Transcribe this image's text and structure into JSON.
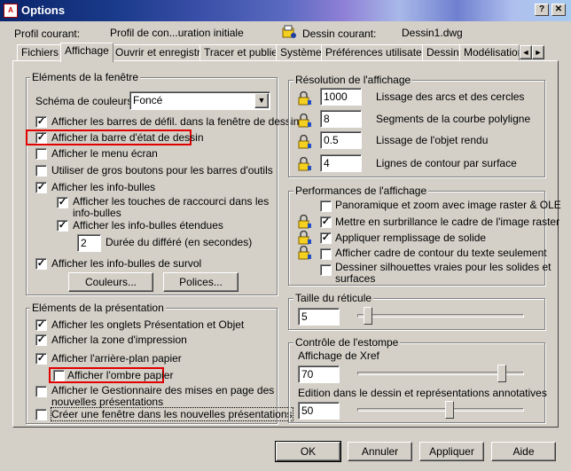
{
  "window": {
    "app_icon_text": "A",
    "title": "Options",
    "help_glyph": "?",
    "close_glyph": "✕"
  },
  "header": {
    "profile_label": "Profil courant:",
    "profile_value": "Profil de con...uration initiale",
    "drawing_label": "Dessin courant:",
    "drawing_value": "Dessin1.dwg"
  },
  "tabs": [
    {
      "label": "Fichiers"
    },
    {
      "label": "Affichage"
    },
    {
      "label": "Ouvrir et enregistrer"
    },
    {
      "label": "Tracer et publier"
    },
    {
      "label": "Système"
    },
    {
      "label": "Préférences utilisateur"
    },
    {
      "label": "Dessin"
    },
    {
      "label": "Modélisation 3D"
    }
  ],
  "tab_scroll": {
    "left": "◄",
    "right": "►"
  },
  "window_elements": {
    "title": "Eléments de la fenêtre",
    "scheme_label": "Schéma de couleurs:",
    "scheme_value": "Foncé",
    "checkboxes": [
      {
        "label": "Afficher les barres de défil. dans la fenêtre de dessin",
        "checked": true
      },
      {
        "label": "Afficher la barre d'état de dessin",
        "checked": true
      },
      {
        "label": "Afficher le menu écran",
        "checked": false
      },
      {
        "label": "Utiliser de gros boutons pour les barres d'outils",
        "checked": false
      },
      {
        "label": "Afficher les info-bulles",
        "checked": true
      }
    ],
    "sub_shortcut_line1": "Afficher les touches de raccourci dans les",
    "sub_shortcut_line2": "info-bulles",
    "sub_extended": "Afficher les info-bulles étendues",
    "delay_value": "2",
    "delay_label": "Durée du différé (en secondes)",
    "rollover": "Afficher les info-bulles de survol",
    "colors_button": "Couleurs...",
    "fonts_button": "Polices..."
  },
  "layout_elements": {
    "title": "Eléments de la présentation",
    "checkboxes": [
      {
        "label": "Afficher les onglets Présentation et Objet",
        "checked": true
      },
      {
        "label": "Afficher la zone d'impression",
        "checked": true
      },
      {
        "label": "Afficher l'arrière-plan papier",
        "checked": true
      }
    ],
    "shadow": "Afficher l'ombre papier",
    "page_setup_line1": "Afficher le Gestionnaire des mises en page des",
    "page_setup_line2": "nouvelles présentations",
    "create_viewport": "Créer une fenêtre dans les nouvelles présentations"
  },
  "resolution": {
    "title": "Résolution de l'affichage",
    "rows": [
      {
        "value": "1000",
        "label": "Lissage des arcs et des cercles"
      },
      {
        "value": "8",
        "label": "Segments de la courbe polyligne"
      },
      {
        "value": "0.5",
        "label": "Lissage de l'objet rendu"
      },
      {
        "value": "4",
        "label": "Lignes de contour par surface"
      }
    ]
  },
  "performance": {
    "title": "Performances de l'affichage",
    "items": [
      {
        "label": "Panoramique et zoom avec image raster & OLE",
        "checked": false
      },
      {
        "label": "Mettre en surbrillance le cadre de l'image raster",
        "checked": true
      },
      {
        "label": "Appliquer remplissage de solide",
        "checked": true
      },
      {
        "label": "Afficher cadre de contour du texte seulement",
        "checked": false
      }
    ],
    "silhouette_line1": "Dessiner silhouettes vraies pour les solides et",
    "silhouette_line2": "surfaces"
  },
  "crosshair": {
    "title": "Taille du réticule",
    "value": "5",
    "slider_level": 5
  },
  "fade": {
    "title": "Contrôle de l'estompe",
    "xref_label": "Affichage de Xref",
    "xref_value": "70",
    "xref_level": 70,
    "inplace_label": "Edition dans le dessin et représentations annotatives",
    "inplace_value": "50",
    "inplace_level": 50
  },
  "buttons": {
    "ok": "OK",
    "cancel": "Annuler",
    "apply": "Appliquer",
    "help": "Aide"
  },
  "icons": {
    "lock": "lock-icon",
    "dropdown": "chevron-down-icon"
  },
  "colors": {
    "highlight": "#e00000",
    "title_bar": "#0a246a"
  }
}
